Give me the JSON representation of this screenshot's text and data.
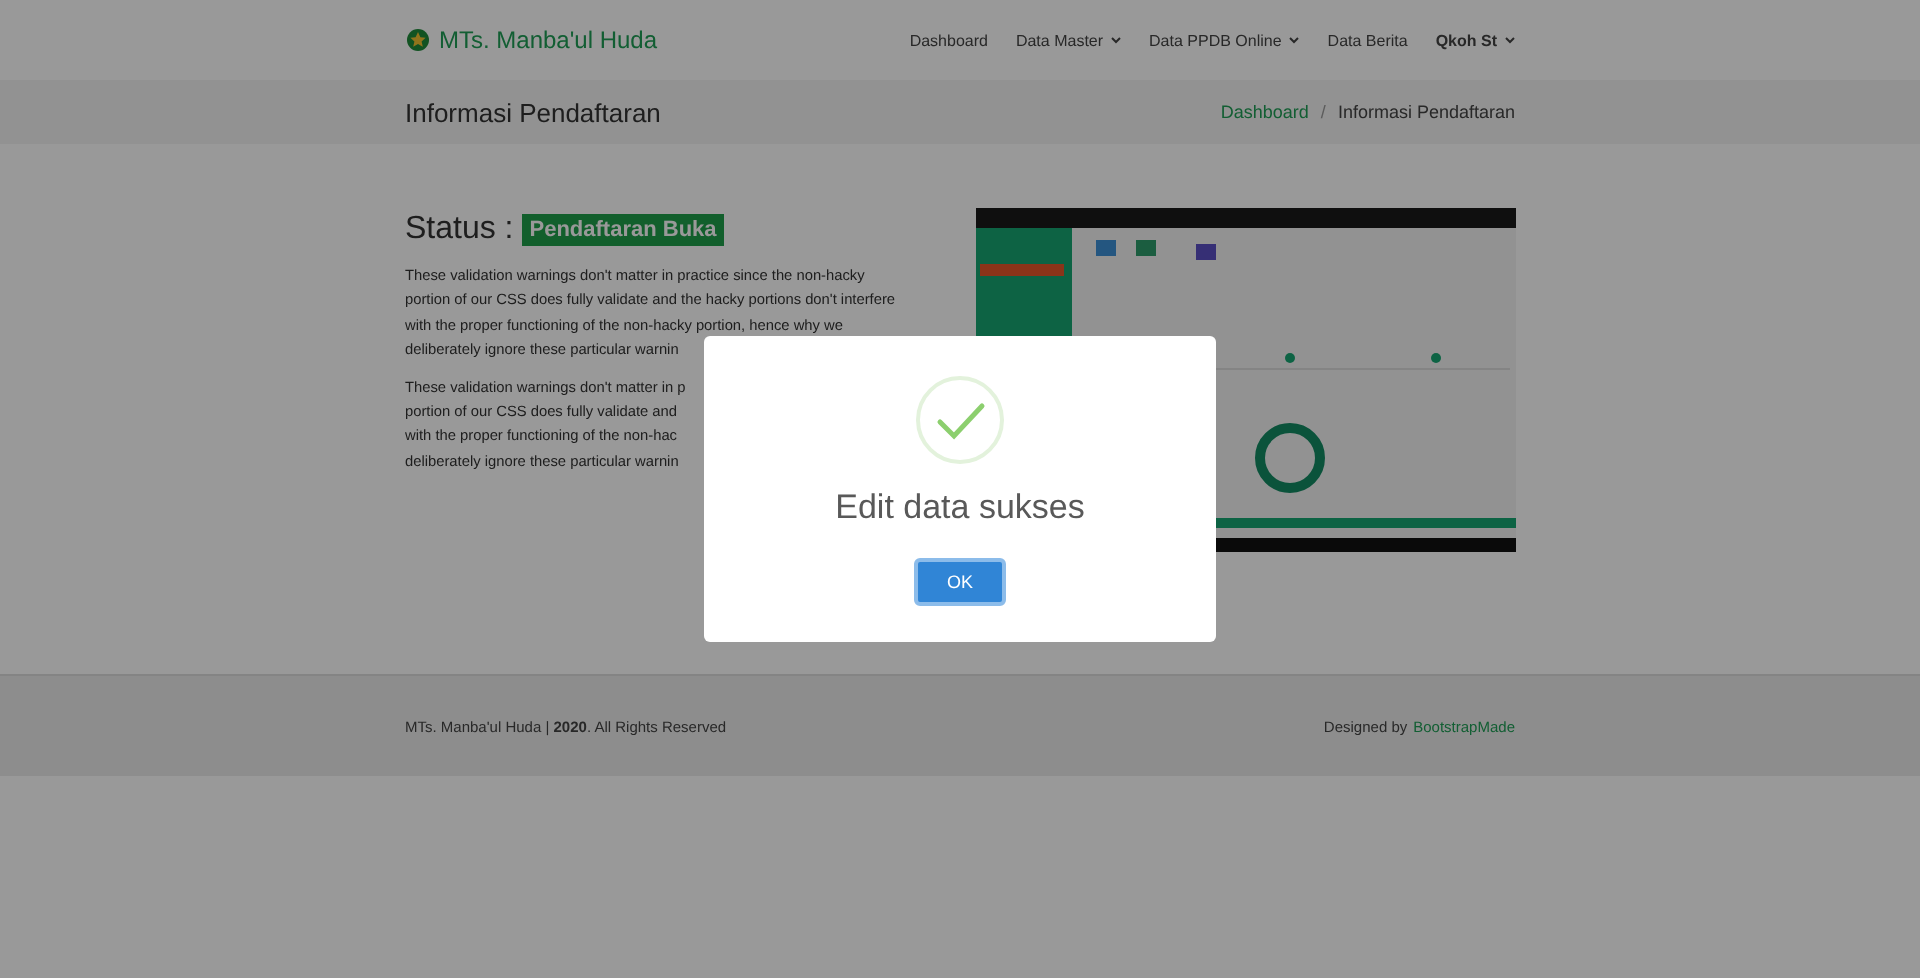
{
  "navbar": {
    "brand": "MTs. Manba'ul Huda",
    "items": [
      {
        "label": "Dashboard",
        "kind": "link",
        "dropdown": false
      },
      {
        "label": "Data Master",
        "kind": "link",
        "dropdown": true
      },
      {
        "label": "Data PPDB Online",
        "kind": "link",
        "dropdown": true
      },
      {
        "label": "Data Berita",
        "kind": "link",
        "dropdown": false
      },
      {
        "label": "Qkoh St",
        "kind": "user",
        "dropdown": true
      }
    ]
  },
  "page_header": {
    "title": "Informasi Pendaftaran",
    "separator": "/",
    "breadcrumb": [
      {
        "label": "Dashboard",
        "kind": "link"
      },
      {
        "label": "Informasi Pendaftaran",
        "kind": "current"
      }
    ]
  },
  "status": {
    "label": "Status :",
    "badge": "Pendaftaran Buka"
  },
  "paragraphs": [
    [
      "These validation warnings don't matter in practice since the non-hacky",
      "portion of our CSS does fully validate and the hacky portions don't interfere",
      "with the proper functioning of the non-hacky portion, hence why we",
      "deliberately ignore these particular warnin"
    ],
    [
      "These validation warnings don't matter in p",
      "portion of our CSS does fully validate and",
      "with the proper functioning of the non-hac",
      "deliberately ignore these particular warnin"
    ]
  ],
  "image": {
    "kind": "picture"
  },
  "footer": {
    "copyright": "MTs. Manba'ul Huda | **2020**. All Rights Reserved",
    "credit": "Designed by",
    "credit_link": "BootstrapMade"
  },
  "modal": {
    "message": "Edit data sukses",
    "button": "OK"
  }
}
